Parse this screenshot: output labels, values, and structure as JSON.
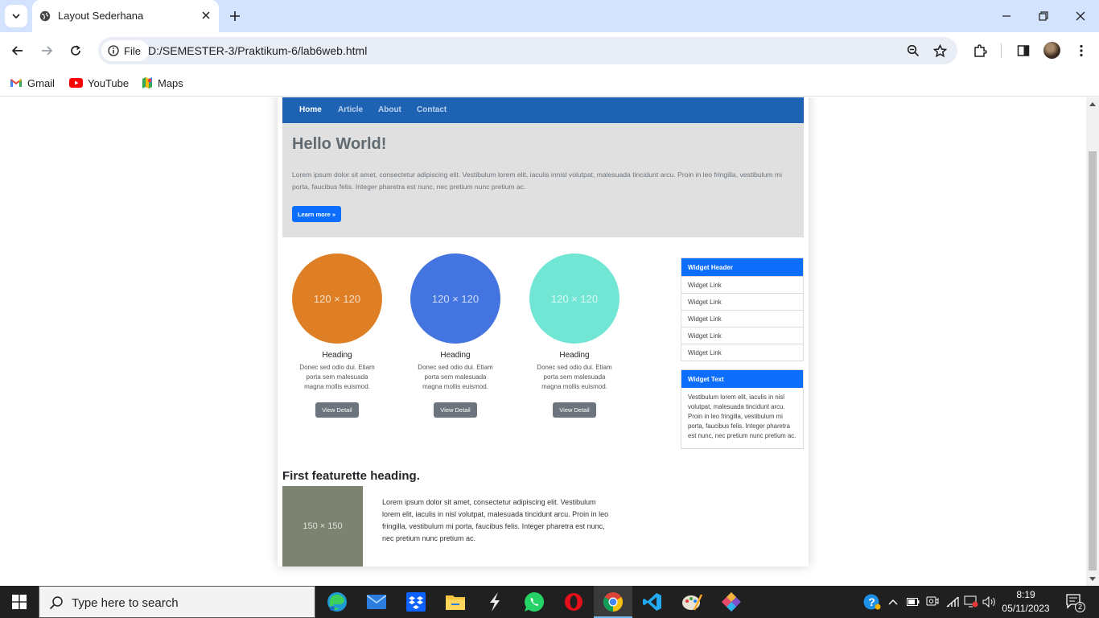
{
  "browser": {
    "tab_title": "Layout Sederhana",
    "site_chip": "File",
    "url": "D:/SEMESTER-3/Praktikum-6/lab6web.html",
    "bookmarks": [
      {
        "label": "Gmail",
        "icon": "gmail-icon"
      },
      {
        "label": "YouTube",
        "icon": "youtube-icon"
      },
      {
        "label": "Maps",
        "icon": "maps-icon"
      }
    ]
  },
  "site": {
    "nav": [
      "Home",
      "Article",
      "About",
      "Contact"
    ],
    "active_nav": "Home",
    "hero": {
      "title": "Hello World!",
      "text": "Lorem ipsum dolor sit amet, consectetur adipiscing elit. Vestibulum lorem elit, iaculis innisl volutpat, malesuada tincidunt arcu. Proin in leo fringilla, vestibulum mi porta, faucibus felis. Integer pharetra est nunc, nec pretium nunc pretium ac.",
      "button": "Learn more »"
    },
    "cards": [
      {
        "placeholder": "120 × 120",
        "color": "#de7f26",
        "heading": "Heading",
        "text": "Donec sed odio dui. Etiam porta sem malesuada magna mollis euismod.",
        "button": "View Detail"
      },
      {
        "placeholder": "120 × 120",
        "color": "#4374e0",
        "heading": "Heading",
        "text": "Donec sed odio dui. Etiam porta sem malesuada magna mollis euismod.",
        "button": "View Detail"
      },
      {
        "placeholder": "120 × 120",
        "color": "#72e6d4",
        "heading": "Heading",
        "text": "Donec sed odio dui. Etiam porta sem malesuada magna mollis euismod.",
        "button": "View Detail"
      }
    ],
    "widget_links": {
      "header": "Widget Header",
      "links": [
        "Widget Link",
        "Widget Link",
        "Widget Link",
        "Widget Link",
        "Widget Link"
      ]
    },
    "widget_text": {
      "header": "Widget Text",
      "text": "Vestibulum lorem elit, iaculis in nisl volutpat, malesuada tincidunt arcu. Proin in leo fringilla, vestibulum mi porta, faucibus felis. Integer pharetra est nunc, nec pretium nunc pretium ac."
    },
    "featurette": {
      "heading": "First featurette heading.",
      "image_placeholder": "150 × 150",
      "text": "Lorem ipsum dolor sit amet, consectetur adipiscing elit. Vestibulum lorem elit, iaculis in nisl volutpat, malesuada tincidunt arcu. Proin in leo fringilla, vestibulum mi porta, faucibus felis. Integer pharetra est nunc, nec pretium nunc pretium ac."
    }
  },
  "taskbar": {
    "search_placeholder": "Type here to search",
    "time": "8:19",
    "date": "05/11/2023",
    "notification_count": "2"
  },
  "colors": {
    "nav_blue": "#1e63b3",
    "primary": "#0d6efd",
    "tabstrip": "#d3e3fd"
  }
}
